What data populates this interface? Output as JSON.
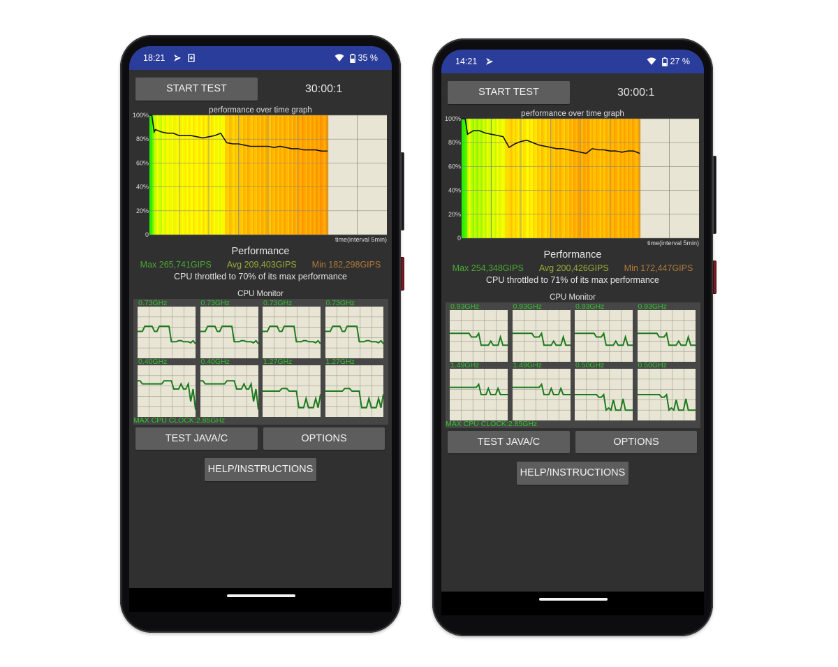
{
  "phones": [
    {
      "status_bar": {
        "time": "18:21",
        "battery": "35 %",
        "icons": [
          "play-store-notification-icon",
          "download-notification-icon",
          "wifi-icon",
          "battery-icon"
        ]
      },
      "start_button": "START TEST",
      "timer": "30:00:1",
      "graph": {
        "title": "performance over time graph",
        "y_ticks": [
          "100%",
          "80%",
          "60%",
          "40%",
          "20%",
          "0"
        ],
        "x_label": "time(interval 5min)"
      },
      "performance": {
        "title": "Performance",
        "max": "Max 265,741GIPS",
        "avg": "Avg 209,403GIPS",
        "min": "Min 182,298GIPS",
        "throttle": "CPU throttled to 70% of its max performance"
      },
      "cpu_monitor": {
        "title": "CPU Monitor",
        "cores": [
          {
            "freq": "0.73GHz",
            "trace": [
              0.48,
              0.48,
              0.48,
              0.38,
              0.38,
              0.38,
              0.38,
              0.48,
              0.48,
              0.38,
              0.38,
              0.38,
              0.38,
              0.38,
              0.68,
              0.68,
              0.68,
              0.66,
              0.66,
              0.68,
              0.68,
              0.68,
              0.7,
              0.66,
              0.72
            ]
          },
          {
            "freq": "0.73GHz",
            "trace": [
              0.48,
              0.48,
              0.48,
              0.38,
              0.38,
              0.38,
              0.38,
              0.48,
              0.48,
              0.38,
              0.38,
              0.38,
              0.38,
              0.38,
              0.68,
              0.68,
              0.68,
              0.66,
              0.66,
              0.68,
              0.68,
              0.68,
              0.7,
              0.66,
              0.72
            ]
          },
          {
            "freq": "0.73GHz",
            "trace": [
              0.48,
              0.48,
              0.48,
              0.38,
              0.38,
              0.38,
              0.38,
              0.48,
              0.48,
              0.38,
              0.38,
              0.38,
              0.38,
              0.38,
              0.68,
              0.68,
              0.68,
              0.66,
              0.66,
              0.68,
              0.68,
              0.68,
              0.7,
              0.66,
              0.72
            ]
          },
          {
            "freq": "0.73GHz",
            "trace": [
              0.48,
              0.48,
              0.48,
              0.38,
              0.38,
              0.38,
              0.38,
              0.48,
              0.48,
              0.38,
              0.38,
              0.38,
              0.38,
              0.38,
              0.68,
              0.68,
              0.68,
              0.66,
              0.66,
              0.68,
              0.68,
              0.68,
              0.7,
              0.66,
              0.72
            ]
          },
          {
            "freq": "0.40GHz",
            "trace": [
              0.3,
              0.3,
              0.36,
              0.36,
              0.36,
              0.36,
              0.36,
              0.36,
              0.36,
              0.36,
              0.36,
              0.3,
              0.3,
              0.3,
              0.3,
              0.46,
              0.46,
              0.46,
              0.36,
              0.46,
              0.46,
              0.36,
              0.7,
              0.46,
              0.86
            ]
          },
          {
            "freq": "0.40GHz",
            "trace": [
              0.3,
              0.3,
              0.36,
              0.36,
              0.36,
              0.36,
              0.36,
              0.36,
              0.36,
              0.36,
              0.36,
              0.3,
              0.3,
              0.3,
              0.3,
              0.46,
              0.46,
              0.46,
              0.36,
              0.46,
              0.46,
              0.36,
              0.7,
              0.46,
              0.86
            ]
          },
          {
            "freq": "1.27GHz",
            "trace": [
              0.5,
              0.5,
              0.5,
              0.5,
              0.5,
              0.5,
              0.5,
              0.5,
              0.45,
              0.45,
              0.45,
              0.5,
              0.5,
              0.5,
              0.5,
              0.82,
              0.82,
              0.82,
              0.64,
              0.82,
              0.82,
              0.82,
              0.64,
              0.82,
              0.56
            ]
          },
          {
            "freq": "1.27GHz",
            "trace": [
              0.5,
              0.5,
              0.5,
              0.5,
              0.5,
              0.5,
              0.5,
              0.5,
              0.45,
              0.45,
              0.45,
              0.5,
              0.5,
              0.5,
              0.5,
              0.82,
              0.82,
              0.82,
              0.64,
              0.82,
              0.82,
              0.82,
              0.64,
              0.82,
              0.56
            ]
          }
        ],
        "max_clock": "MAX CPU CLOCK:2.85GHz"
      },
      "buttons": {
        "test_java": "TEST JAVA/C",
        "options": "OPTIONS",
        "help": "HELP/INSTRUCTIONS"
      }
    },
    {
      "status_bar": {
        "time": "14:21",
        "battery": "27 %",
        "icons": [
          "play-store-notification-icon",
          "wifi-icon",
          "battery-icon"
        ]
      },
      "start_button": "START TEST",
      "timer": "30:00:1",
      "graph": {
        "title": "performance over time graph",
        "y_ticks": [
          "100%",
          "80%",
          "60%",
          "40%",
          "20%",
          "0"
        ],
        "x_label": "time(interval 5min)"
      },
      "performance": {
        "title": "Performance",
        "max": "Max 254,348GIPS",
        "avg": "Avg 200,426GIPS",
        "min": "Min 172,447GIPS",
        "throttle": "CPU throttled to 71% of its max performance"
      },
      "cpu_monitor": {
        "title": "CPU Monitor",
        "cores": [
          {
            "freq": "0.93GHz",
            "trace": [
              0.45,
              0.45,
              0.45,
              0.45,
              0.45,
              0.45,
              0.45,
              0.45,
              0.45,
              0.52,
              0.52,
              0.52,
              0.45,
              0.68,
              0.68,
              0.68,
              0.68,
              0.6,
              0.68,
              0.68,
              0.68,
              0.52,
              0.68,
              0.68,
              0.68
            ]
          },
          {
            "freq": "0.93GHz",
            "trace": [
              0.45,
              0.45,
              0.45,
              0.45,
              0.45,
              0.45,
              0.45,
              0.45,
              0.45,
              0.52,
              0.52,
              0.52,
              0.45,
              0.68,
              0.68,
              0.68,
              0.68,
              0.6,
              0.68,
              0.68,
              0.68,
              0.52,
              0.68,
              0.68,
              0.68
            ]
          },
          {
            "freq": "0.93GHz",
            "trace": [
              0.45,
              0.45,
              0.45,
              0.45,
              0.45,
              0.45,
              0.45,
              0.45,
              0.45,
              0.52,
              0.52,
              0.52,
              0.45,
              0.68,
              0.68,
              0.68,
              0.68,
              0.6,
              0.68,
              0.68,
              0.68,
              0.52,
              0.68,
              0.68,
              0.68
            ]
          },
          {
            "freq": "0.93GHz",
            "trace": [
              0.45,
              0.45,
              0.45,
              0.45,
              0.45,
              0.45,
              0.45,
              0.45,
              0.45,
              0.52,
              0.52,
              0.52,
              0.45,
              0.68,
              0.68,
              0.68,
              0.68,
              0.6,
              0.68,
              0.68,
              0.68,
              0.52,
              0.68,
              0.68,
              0.68
            ]
          },
          {
            "freq": "1.49GHz",
            "trace": [
              0.36,
              0.36,
              0.36,
              0.36,
              0.36,
              0.36,
              0.36,
              0.36,
              0.36,
              0.36,
              0.36,
              0.36,
              0.3,
              0.5,
              0.5,
              0.5,
              0.38,
              0.5,
              0.5,
              0.5,
              0.38,
              0.5,
              0.5,
              0.5,
              0.5
            ]
          },
          {
            "freq": "1.49GHz",
            "trace": [
              0.36,
              0.36,
              0.36,
              0.36,
              0.36,
              0.36,
              0.36,
              0.36,
              0.36,
              0.36,
              0.36,
              0.36,
              0.3,
              0.5,
              0.5,
              0.5,
              0.38,
              0.5,
              0.5,
              0.5,
              0.38,
              0.5,
              0.5,
              0.5,
              0.5
            ]
          },
          {
            "freq": "0.50GHz",
            "trace": [
              0.5,
              0.5,
              0.5,
              0.5,
              0.5,
              0.5,
              0.5,
              0.5,
              0.5,
              0.5,
              0.55,
              0.55,
              0.5,
              0.8,
              0.76,
              0.8,
              0.6,
              0.8,
              0.8,
              0.8,
              0.58,
              0.8,
              0.8,
              0.8,
              0.8
            ]
          },
          {
            "freq": "0.50GHz",
            "trace": [
              0.5,
              0.5,
              0.5,
              0.5,
              0.5,
              0.5,
              0.5,
              0.5,
              0.5,
              0.5,
              0.55,
              0.55,
              0.5,
              0.8,
              0.76,
              0.8,
              0.6,
              0.8,
              0.8,
              0.8,
              0.58,
              0.8,
              0.8,
              0.8,
              0.8
            ]
          }
        ],
        "max_clock": "MAX CPU CLOCK:2.85GHz"
      },
      "buttons": {
        "test_java": "TEST JAVA/C",
        "options": "OPTIONS",
        "help": "HELP/INSTRUCTIONS"
      }
    }
  ],
  "chart_data": [
    {
      "type": "area",
      "title": "performance over time graph",
      "xlabel": "time(interval 5min)",
      "ylabel": "",
      "ylim": [
        0,
        100
      ],
      "xlim_minutes": [
        0,
        40
      ],
      "y_ticks": [
        "0",
        "20%",
        "40%",
        "60%",
        "80%",
        "100%"
      ],
      "grid": true,
      "x_minutes": [
        0,
        0.4,
        0.8,
        1,
        2,
        3,
        4,
        5,
        6,
        7,
        8,
        9,
        10,
        11,
        12,
        13,
        14,
        15,
        16,
        17,
        18,
        19,
        20,
        21,
        22,
        23,
        24,
        25,
        26,
        27,
        28,
        29,
        30
      ],
      "values": [
        100,
        100,
        86,
        88,
        86,
        85,
        85,
        83,
        83,
        83,
        82,
        81,
        82,
        83,
        85,
        77,
        76,
        76,
        75,
        74,
        74,
        74,
        74,
        73,
        74,
        73,
        72,
        72,
        71,
        71,
        71,
        70,
        70
      ]
    },
    {
      "type": "area",
      "title": "performance over time graph",
      "xlabel": "time(interval 5min)",
      "ylabel": "",
      "ylim": [
        0,
        100
      ],
      "xlim_minutes": [
        0,
        40
      ],
      "y_ticks": [
        "0",
        "20%",
        "40%",
        "60%",
        "80%",
        "100%"
      ],
      "grid": true,
      "x_minutes": [
        0,
        0.6,
        1,
        2,
        3,
        4,
        5,
        6,
        7,
        8,
        9,
        10,
        11,
        12,
        13,
        14,
        15,
        16,
        17,
        18,
        19,
        20,
        21,
        22,
        23,
        24,
        25,
        26,
        27,
        28,
        29,
        30
      ],
      "values": [
        100,
        100,
        87,
        90,
        90,
        88,
        87,
        86,
        85,
        76,
        79,
        81,
        82,
        80,
        78,
        77,
        76,
        75,
        75,
        74,
        73,
        72,
        71,
        75,
        74,
        74,
        73,
        73,
        72,
        73,
        73,
        71
      ]
    }
  ]
}
